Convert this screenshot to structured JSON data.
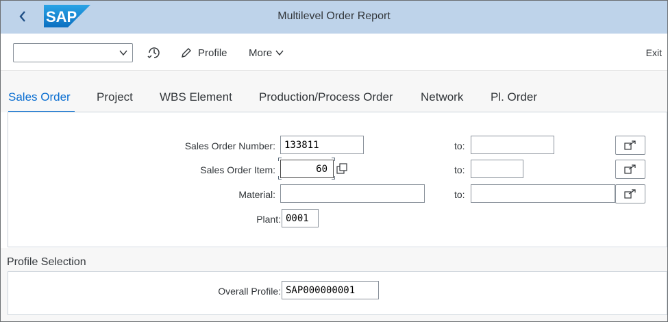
{
  "header": {
    "title": "Multilevel Order Report",
    "logo_text": "SAP",
    "back_icon": "chevron-left-icon"
  },
  "toolbar": {
    "variant_value": "",
    "history_icon": "history-icon",
    "profile_label": "Profile",
    "more_label": "More",
    "exit_label": "Exit"
  },
  "tabs": [
    {
      "label": "Sales Order",
      "active": true
    },
    {
      "label": "Project"
    },
    {
      "label": "WBS Element"
    },
    {
      "label": "Production/Process Order"
    },
    {
      "label": "Network"
    },
    {
      "label": "Pl. Order"
    }
  ],
  "selection": {
    "sales_order_number": {
      "label": "Sales Order Number:",
      "value": "133811",
      "to_label": "to:",
      "to_value": ""
    },
    "sales_order_item": {
      "label": "Sales Order Item:",
      "value": "60",
      "to_label": "to:",
      "to_value": ""
    },
    "material": {
      "label": "Material:",
      "value": "",
      "to_label": "to:",
      "to_value": ""
    },
    "plant": {
      "label": "Plant:",
      "value": "0001"
    }
  },
  "profile_selection": {
    "title": "Profile Selection",
    "overall_profile": {
      "label": "Overall Profile:",
      "value": "SAP000000001"
    }
  },
  "colors": {
    "shell": "#bed3ea",
    "accent": "#0a6ed1",
    "logo": "#1a8fd6"
  }
}
